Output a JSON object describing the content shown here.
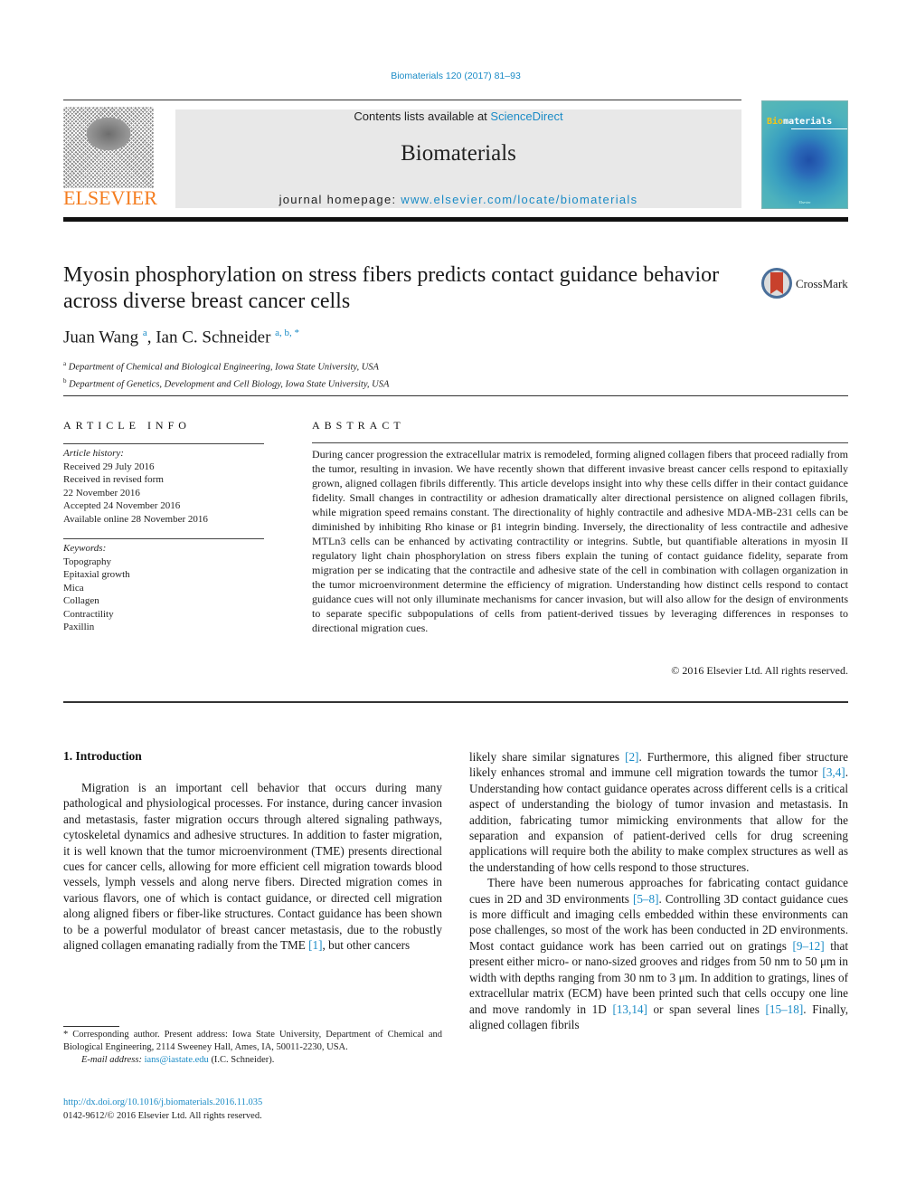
{
  "header": {
    "citation": "Biomaterials 120 (2017) 81–93",
    "contents_prefix": "Contents lists available at ",
    "contents_link": "ScienceDirect",
    "journal_name": "Biomaterials",
    "homepage_prefix": "journal homepage: ",
    "homepage_link": "www.elsevier.com/locate/biomaterials",
    "publisher_logo_text": "ELSEVIER",
    "cover": {
      "title_highlight": "Bio",
      "title_rest": "materials",
      "publisher": "Elsevier"
    }
  },
  "colors": {
    "link": "#1a8bc6",
    "elsevier_orange": "#f47d20",
    "banner_bg": "#e8e8e8",
    "crossmark_red": "#c8412c"
  },
  "article": {
    "title": "Myosin phosphorylation on stress fibers predicts contact guidance behavior across diverse breast cancer cells",
    "crossmark_label": "CrossMark",
    "authors": [
      {
        "name": "Juan Wang",
        "sup": "a"
      },
      {
        "name": "Ian C. Schneider",
        "sup": "a, b, *"
      }
    ],
    "affiliations": [
      {
        "sup": "a",
        "text": "Department of Chemical and Biological Engineering, Iowa State University, USA"
      },
      {
        "sup": "b",
        "text": "Department of Genetics, Development and Cell Biology, Iowa State University, USA"
      }
    ]
  },
  "article_info": {
    "label": "ARTICLE INFO",
    "history_label": "Article history:",
    "history": [
      "Received 29 July 2016",
      "Received in revised form",
      "22 November 2016",
      "Accepted 24 November 2016",
      "Available online 28 November 2016"
    ],
    "keywords_label": "Keywords:",
    "keywords": [
      "Topography",
      "Epitaxial growth",
      "Mica",
      "Collagen",
      "Contractility",
      "Paxillin"
    ]
  },
  "abstract": {
    "label": "ABSTRACT",
    "text": "During cancer progression the extracellular matrix is remodeled, forming aligned collagen fibers that proceed radially from the tumor, resulting in invasion. We have recently shown that different invasive breast cancer cells respond to epitaxially grown, aligned collagen fibrils differently. This article develops insight into why these cells differ in their contact guidance fidelity. Small changes in contractility or adhesion dramatically alter directional persistence on aligned collagen fibrils, while migration speed remains constant. The directionality of highly contractile and adhesive MDA-MB-231 cells can be diminished by inhibiting Rho kinase or β1 integrin binding. Inversely, the directionality of less contractile and adhesive MTLn3 cells can be enhanced by activating contractility or integrins. Subtle, but quantifiable alterations in myosin II regulatory light chain phosphorylation on stress fibers explain the tuning of contact guidance fidelity, separate from migration per se indicating that the contractile and adhesive state of the cell in combination with collagen organization in the tumor microenvironment determine the efficiency of migration. Understanding how distinct cells respond to contact guidance cues will not only illuminate mechanisms for cancer invasion, but will also allow for the design of environments to separate specific subpopulations of cells from patient-derived tissues by leveraging differences in responses to directional migration cues.",
    "copyright": "© 2016 Elsevier Ltd. All rights reserved."
  },
  "body": {
    "section_heading": "1.  Introduction",
    "left": {
      "p1_a": "Migration is an important cell behavior that occurs during many pathological and physiological processes. For instance, during cancer invasion and metastasis, faster migration occurs through altered signaling pathways, cytoskeletal dynamics and adhesive structures. In addition to faster migration, it is well known that the tumor microenvironment (TME) presents directional cues for cancer cells, allowing for more efficient cell migration towards blood vessels, lymph vessels and along nerve fibers. Directed migration comes in various flavors, one of which is contact guidance, or directed cell migration along aligned fibers or fiber-like structures. Contact guidance has been shown to be a powerful modulator of breast cancer metastasis, due to the robustly aligned collagen emanating radially from the TME ",
      "ref1": "[1]",
      "p1_b": ", but other cancers"
    },
    "right": {
      "p1_a": "likely share similar signatures ",
      "ref2": "[2]",
      "p1_b": ". Furthermore, this aligned fiber structure likely enhances stromal and immune cell migration towards the tumor ",
      "ref3": "[3,4]",
      "p1_c": ". Understanding how contact guidance operates across different cells is a critical aspect of understanding the biology of tumor invasion and metastasis. In addition, fabricating tumor mimicking environments that allow for the separation and expansion of patient-derived cells for drug screening applications will require both the ability to make complex structures as well as the understanding of how cells respond to those structures.",
      "p2_a": "There have been numerous approaches for fabricating contact guidance cues in 2D and 3D environments ",
      "ref4": "[5–8]",
      "p2_b": ". Controlling 3D contact guidance cues is more difficult and imaging cells embedded within these environments can pose challenges, so most of the work has been conducted in 2D environments. Most contact guidance work has been carried out on gratings ",
      "ref5": "[9–12]",
      "p2_c": " that present either micro- or nano-sized grooves and ridges from 50 nm to 50 μm in width with depths ranging from 30 nm to 3 μm. In addition to gratings, lines of extracellular matrix (ECM) have been printed such that cells occupy one line and move randomly in 1D ",
      "ref6": "[13,14]",
      "p2_d": " or span several lines ",
      "ref7": "[15–18]",
      "p2_e": ". Finally, aligned collagen fibrils"
    }
  },
  "footnote": {
    "corresponding": "* Corresponding author. Present address: Iowa State University, Department of Chemical and Biological Engineering, 2114 Sweeney Hall, Ames, IA, 50011-2230, USA.",
    "email_label": "E-mail address: ",
    "email": "ians@iastate.edu",
    "email_suffix": " (I.C. Schneider).",
    "doi": "http://dx.doi.org/10.1016/j.biomaterials.2016.11.035",
    "issn": "0142-9612/© 2016 Elsevier Ltd. All rights reserved."
  }
}
